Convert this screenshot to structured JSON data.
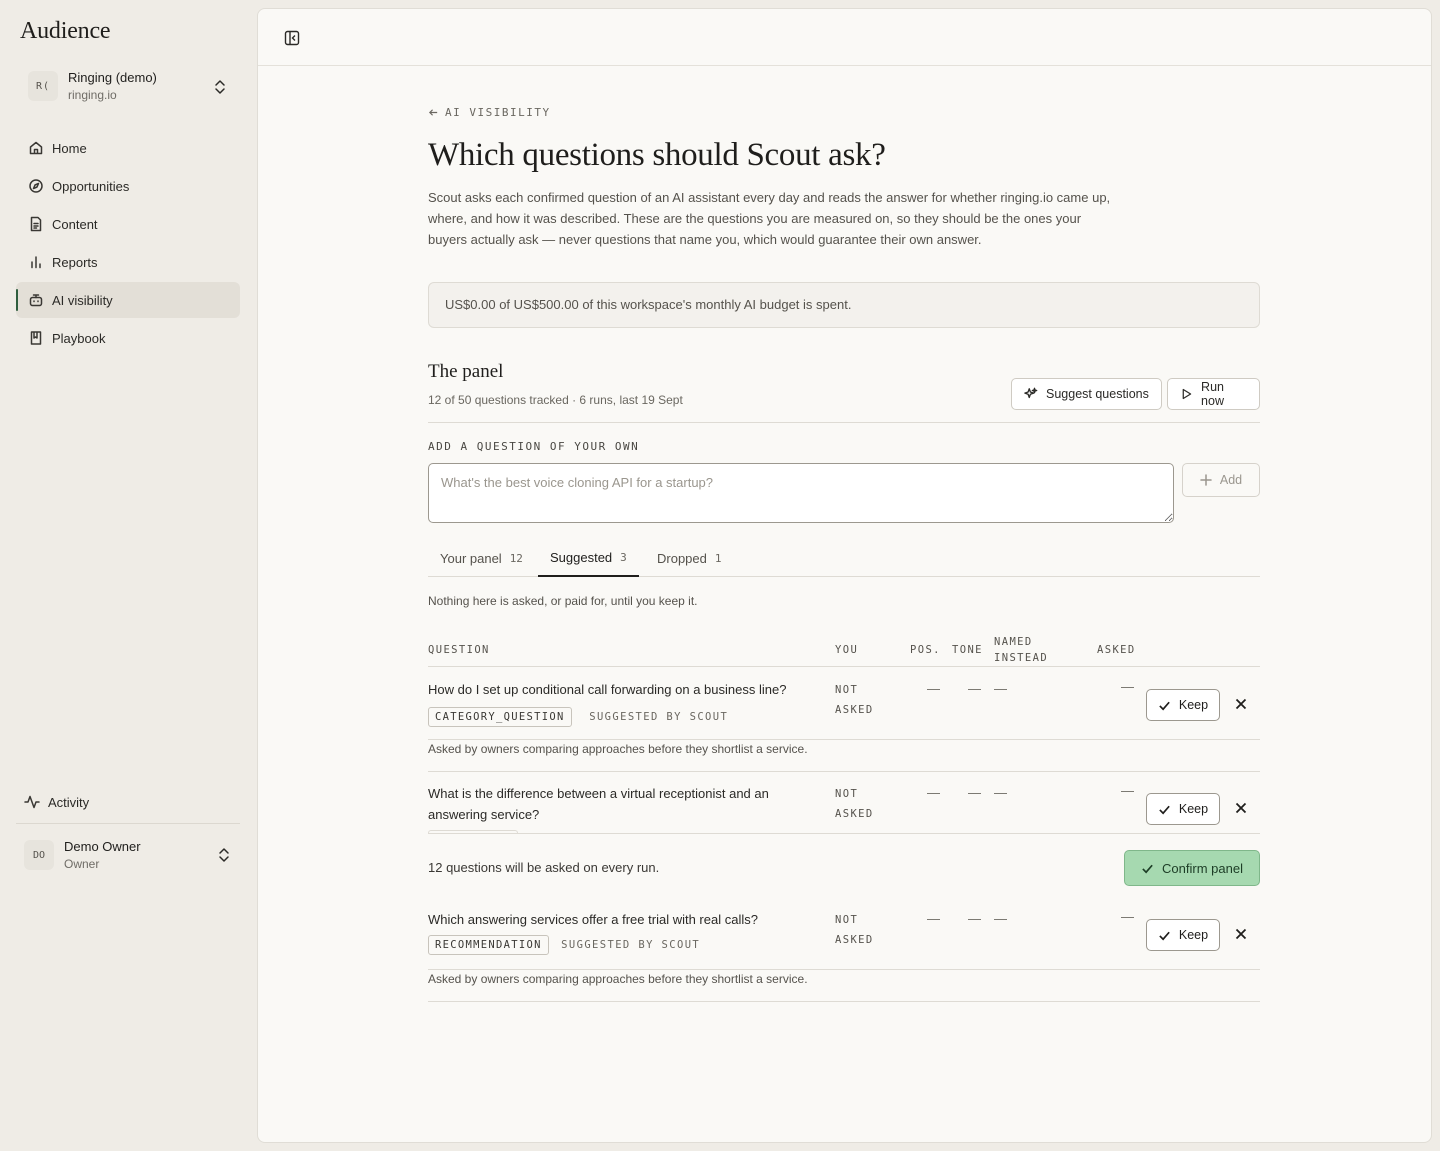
{
  "app": {
    "title": "Audience"
  },
  "workspace": {
    "initials": "R(",
    "name": "Ringing (demo)",
    "domain": "ringing.io"
  },
  "nav": {
    "items": [
      {
        "label": "Home",
        "icon": "home-icon"
      },
      {
        "label": "Opportunities",
        "icon": "compass-icon"
      },
      {
        "label": "Content",
        "icon": "document-icon"
      },
      {
        "label": "Reports",
        "icon": "bar-chart-icon"
      },
      {
        "label": "AI visibility",
        "icon": "robot-icon",
        "active": true
      },
      {
        "label": "Playbook",
        "icon": "book-icon"
      }
    ],
    "activity": "Activity"
  },
  "user": {
    "initials": "DO",
    "name": "Demo Owner",
    "role": "Owner"
  },
  "page": {
    "back": "AI VISIBILITY",
    "title": "Which questions should Scout ask?",
    "intro": "Scout asks each confirmed question of an AI assistant every day and reads the answer for whether ringing.io came up, where, and how it was described. These are the questions you are measured on, so they should be the ones your buyers actually ask — never questions that name you, which would guarantee their own answer.",
    "budget": "US$0.00 of US$500.00 of this workspace's monthly AI budget is spent."
  },
  "panel": {
    "title": "The panel",
    "meta": "12 of 50 questions tracked · 6 runs, last 19 Sept",
    "suggest_label": "Suggest questions",
    "run_label": "Run now",
    "add_label": "ADD A QUESTION OF YOUR OWN",
    "input_placeholder": "What's the best voice cloning API for a startup?",
    "input_value": "",
    "add_button": "Add"
  },
  "tabs": [
    {
      "label": "Your panel",
      "count": "12"
    },
    {
      "label": "Suggested",
      "count": "3",
      "active": true
    },
    {
      "label": "Dropped",
      "count": "1"
    }
  ],
  "suggested": {
    "note": "Nothing here is asked, or paid for, until you keep it.",
    "columns": {
      "question": "QUESTION",
      "you": "YOU",
      "pos": "POS.",
      "tone": "TONE",
      "named_1": "NAMED",
      "named_2": "INSTEAD",
      "asked": "ASKED"
    },
    "rows": [
      {
        "question": "How do I set up conditional call forwarding on a business line?",
        "you_1": "NOT",
        "you_2": "ASKED",
        "pos": "—",
        "tone": "—",
        "named": "—",
        "asked": "—",
        "category": "CATEGORY_QUESTION",
        "source": "SUGGESTED BY SCOUT",
        "why": "Asked by owners comparing approaches before they shortlist a service.",
        "keep": "Keep"
      },
      {
        "question_1": "What is the difference between a virtual receptionist and an",
        "question_2": "answering service?",
        "you_1": "NOT",
        "you_2": "ASKED",
        "pos": "—",
        "tone": "—",
        "named": "—",
        "asked": "—",
        "keep": "Keep"
      },
      {
        "question": "Which answering services offer a free trial with real calls?",
        "you_1": "NOT",
        "you_2": "ASKED",
        "pos": "—",
        "tone": "—",
        "named": "—",
        "asked": "—",
        "category": "RECOMMENDATION",
        "source": "SUGGESTED BY SCOUT",
        "why": "Asked by owners comparing approaches before they shortlist a service.",
        "keep": "Keep"
      }
    ]
  },
  "confirm": {
    "message": "12 questions will be asked on every run.",
    "button": "Confirm panel"
  },
  "colors": {
    "accent": "#2f5e3e",
    "confirm_bg": "#a6d9b0",
    "background": "#efece6",
    "panel": "#faf9f6"
  }
}
